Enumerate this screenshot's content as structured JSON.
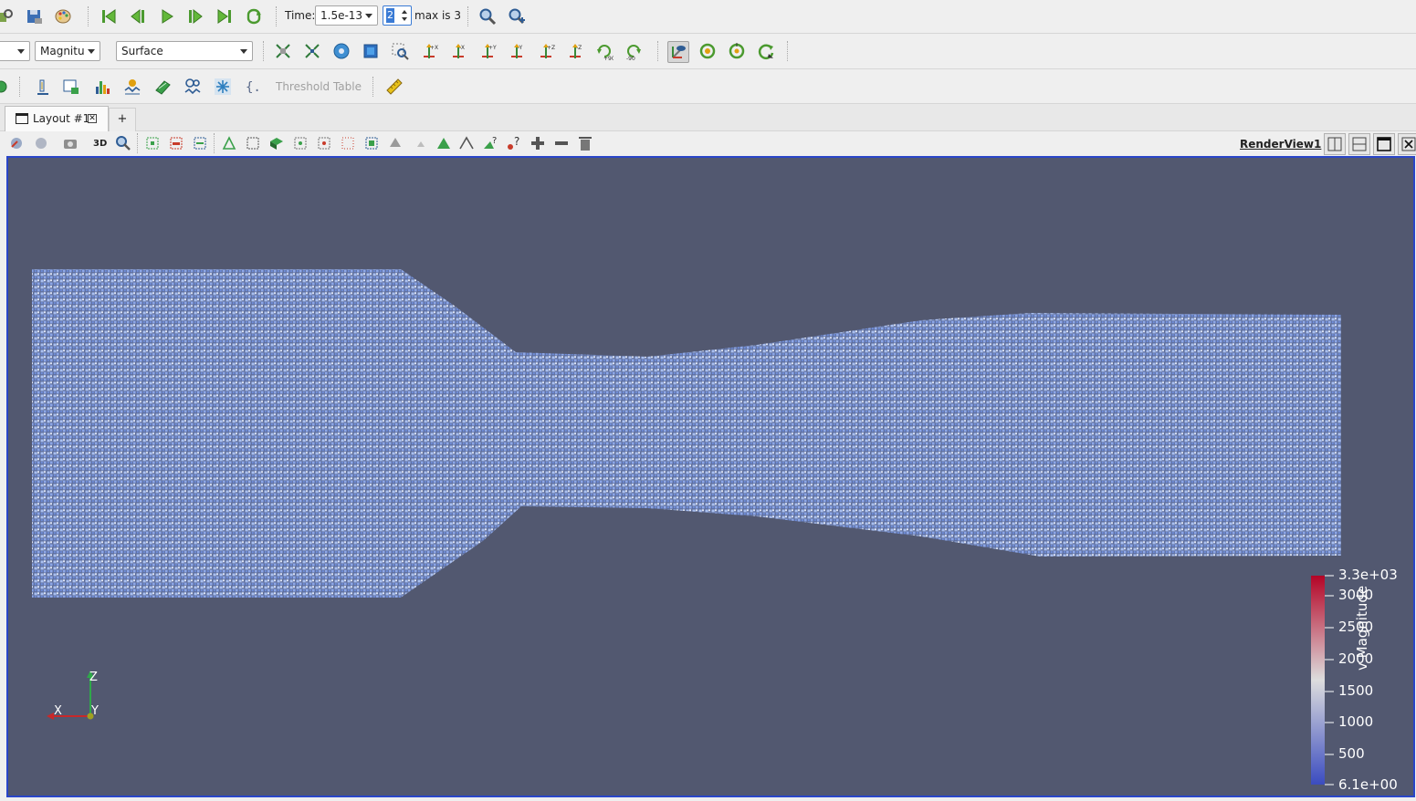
{
  "toolbar_time": {
    "time_label": "Time:",
    "time_value": "1.5e-13",
    "timestep_value": "2",
    "max_label": "max is 3"
  },
  "toolbar_representation": {
    "coloring_component": "Magnitu",
    "representation": "Surface"
  },
  "toolbar_filters": {
    "threshold_table_label": "Threshold Table"
  },
  "layout_tabs": {
    "tabs": [
      {
        "label": "Layout #1"
      }
    ],
    "add_tab_label": "+"
  },
  "view_toolbar": {
    "mode_3d_label": "3D",
    "view_name": "RenderView1"
  },
  "render_view": {
    "background_color": "#525870",
    "frame_color": "#2a46c9",
    "axes": {
      "x_label": "X",
      "y_label": "Y",
      "z_label": "Z"
    },
    "color_legend": {
      "title": "v Magnitude",
      "max_label": "3.3e+03",
      "min_label": "6.1e+00",
      "ticks": [
        "3000",
        "2500",
        "2000",
        "1500",
        "1000",
        "500"
      ],
      "colormap": [
        "#3b4cc0",
        "#dddddd",
        "#b40426"
      ]
    }
  }
}
